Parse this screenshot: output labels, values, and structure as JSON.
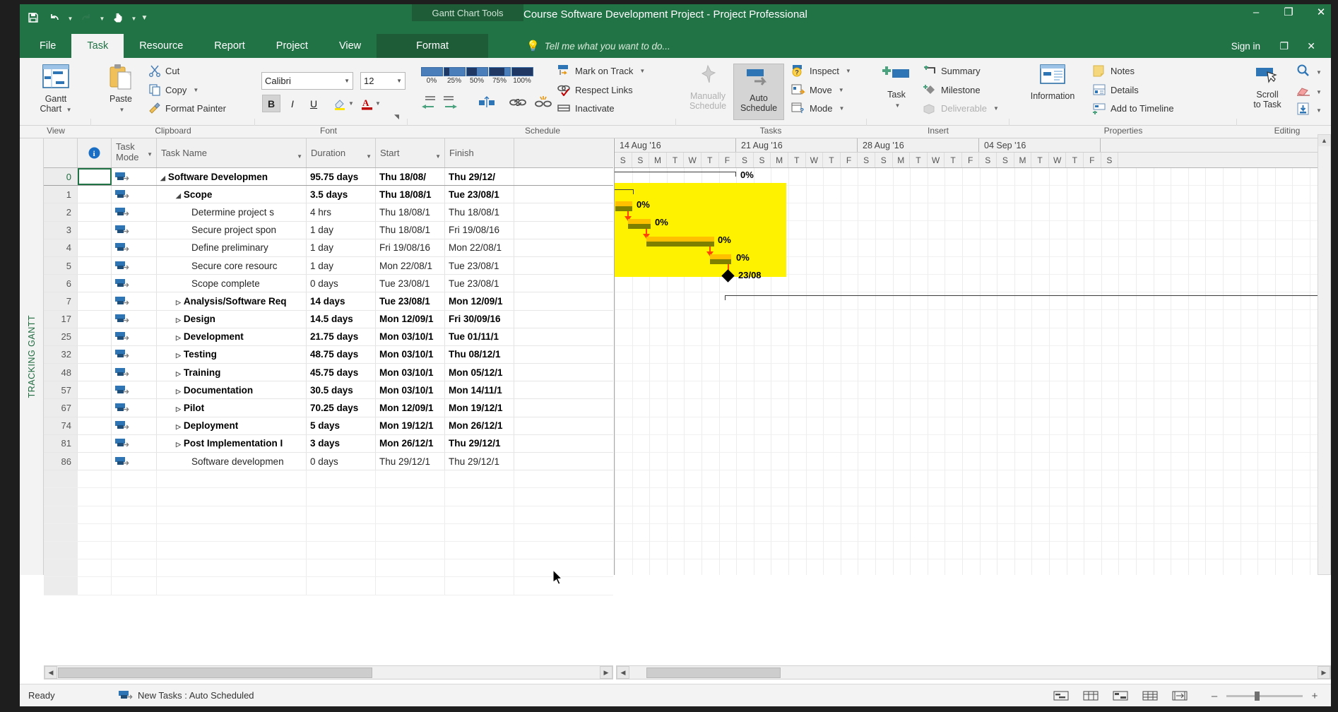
{
  "window": {
    "context_tab_group": "Gantt Chart Tools",
    "title": "Course Software Development Project - Project Professional",
    "minimize": "–",
    "restore": "❐",
    "close": "✕",
    "sign_in": "Sign in",
    "ribbon_display_options": "❐",
    "ribbon_close": "✕"
  },
  "quick_access": {
    "save": "save-icon",
    "undo": "undo-icon",
    "redo": "redo-icon",
    "touch_mode": "touch-mode-icon",
    "customize": "customize-icon"
  },
  "tabs": [
    {
      "label": "File",
      "active": false
    },
    {
      "label": "Task",
      "active": true
    },
    {
      "label": "Resource",
      "active": false
    },
    {
      "label": "Report",
      "active": false
    },
    {
      "label": "Project",
      "active": false
    },
    {
      "label": "View",
      "active": false
    },
    {
      "label": "Format",
      "active": false,
      "contextual": true
    }
  ],
  "tell_me": {
    "placeholder": "Tell me what you want to do..."
  },
  "ribbon": {
    "groups": [
      {
        "name": "View",
        "label": "View"
      },
      {
        "name": "Clipboard",
        "label": "Clipboard"
      },
      {
        "name": "Font",
        "label": "Font"
      },
      {
        "name": "Schedule",
        "label": "Schedule"
      },
      {
        "name": "Tasks",
        "label": "Tasks"
      },
      {
        "name": "Insert",
        "label": "Insert"
      },
      {
        "name": "Properties",
        "label": "Properties"
      },
      {
        "name": "Editing",
        "label": "Editing"
      }
    ],
    "view": {
      "gantt_chart_line1": "Gantt",
      "gantt_chart_line2": "Chart"
    },
    "clipboard": {
      "paste": "Paste",
      "cut": "Cut",
      "copy": "Copy",
      "format_painter": "Format Painter"
    },
    "font": {
      "font_name": "Calibri",
      "font_size": "12",
      "bold": "B",
      "italic": "I",
      "underline": "U",
      "highlight": "highlight-color-icon",
      "font_color": "A"
    },
    "schedule": {
      "percent_0": "0%",
      "percent_25": "25%",
      "percent_50": "50%",
      "percent_75": "75%",
      "percent_100": "100%",
      "mark_on_track": "Mark on Track",
      "respect_links": "Respect Links",
      "inactivate": "Inactivate"
    },
    "tasks": {
      "manually_schedule_line1": "Manually",
      "manually_schedule_line2": "Schedule",
      "auto_schedule_line1": "Auto",
      "auto_schedule_line2": "Schedule",
      "inspect": "Inspect",
      "move": "Move",
      "mode": "Mode"
    },
    "insert": {
      "task": "Task",
      "summary": "Summary",
      "milestone": "Milestone",
      "deliverable": "Deliverable"
    },
    "properties": {
      "information": "Information",
      "notes": "Notes",
      "details": "Details",
      "add_to_timeline": "Add to Timeline"
    },
    "editing": {
      "scroll_to_task_line1": "Scroll",
      "scroll_to_task_line2": "to Task",
      "find": "find-icon",
      "clear": "clear-icon",
      "fill": "fill-down-icon"
    }
  },
  "view_side_label": "TRACKING GANTT",
  "grid": {
    "headers": {
      "id": "",
      "indicator": "ⓘ",
      "task_mode_line1": "Task",
      "task_mode_line2": "Mode",
      "task_name": "Task Name",
      "duration": "Duration",
      "start": "Start",
      "finish": "Finish"
    },
    "rows": [
      {
        "id": "0",
        "name": "Software Developmen",
        "duration": "95.75 days",
        "start": "Thu 18/08/",
        "finish": "Thu 29/12/",
        "bold": true,
        "indent": 0,
        "twisty": "◢",
        "selected": true
      },
      {
        "id": "1",
        "name": "Scope",
        "duration": "3.5 days",
        "start": "Thu 18/08/1",
        "finish": "Tue 23/08/1",
        "bold": true,
        "indent": 1,
        "twisty": "◢"
      },
      {
        "id": "2",
        "name": "Determine project s",
        "duration": "4 hrs",
        "start": "Thu 18/08/1",
        "finish": "Thu 18/08/1",
        "bold": false,
        "indent": 2,
        "twisty": ""
      },
      {
        "id": "3",
        "name": "Secure project spon",
        "duration": "1 day",
        "start": "Thu 18/08/1",
        "finish": "Fri 19/08/16",
        "bold": false,
        "indent": 2,
        "twisty": ""
      },
      {
        "id": "4",
        "name": "Define preliminary",
        "duration": "1 day",
        "start": "Fri 19/08/16",
        "finish": "Mon 22/08/1",
        "bold": false,
        "indent": 2,
        "twisty": ""
      },
      {
        "id": "5",
        "name": "Secure core resourc",
        "duration": "1 day",
        "start": "Mon 22/08/1",
        "finish": "Tue 23/08/1",
        "bold": false,
        "indent": 2,
        "twisty": ""
      },
      {
        "id": "6",
        "name": "Scope complete",
        "duration": "0 days",
        "start": "Tue 23/08/1",
        "finish": "Tue 23/08/1",
        "bold": false,
        "indent": 2,
        "twisty": ""
      },
      {
        "id": "7",
        "name": "Analysis/Software Req",
        "duration": "14 days",
        "start": "Tue 23/08/1",
        "finish": "Mon 12/09/1",
        "bold": true,
        "indent": 1,
        "twisty": "▷"
      },
      {
        "id": "17",
        "name": "Design",
        "duration": "14.5 days",
        "start": "Mon 12/09/1",
        "finish": "Fri 30/09/16",
        "bold": true,
        "indent": 1,
        "twisty": "▷"
      },
      {
        "id": "25",
        "name": "Development",
        "duration": "21.75 days",
        "start": "Mon 03/10/1",
        "finish": "Tue 01/11/1",
        "bold": true,
        "indent": 1,
        "twisty": "▷"
      },
      {
        "id": "32",
        "name": "Testing",
        "duration": "48.75 days",
        "start": "Mon 03/10/1",
        "finish": "Thu 08/12/1",
        "bold": true,
        "indent": 1,
        "twisty": "▷"
      },
      {
        "id": "48",
        "name": "Training",
        "duration": "45.75 days",
        "start": "Mon 03/10/1",
        "finish": "Mon 05/12/1",
        "bold": true,
        "indent": 1,
        "twisty": "▷"
      },
      {
        "id": "57",
        "name": "Documentation",
        "duration": "30.5 days",
        "start": "Mon 03/10/1",
        "finish": "Mon 14/11/1",
        "bold": true,
        "indent": 1,
        "twisty": "▷"
      },
      {
        "id": "67",
        "name": "Pilot",
        "duration": "70.25 days",
        "start": "Mon 12/09/1",
        "finish": "Mon 19/12/1",
        "bold": true,
        "indent": 1,
        "twisty": "▷"
      },
      {
        "id": "74",
        "name": "Deployment",
        "duration": "5 days",
        "start": "Mon 19/12/1",
        "finish": "Mon 26/12/1",
        "bold": true,
        "indent": 1,
        "twisty": "▷"
      },
      {
        "id": "81",
        "name": "Post Implementation I",
        "duration": "3 days",
        "start": "Mon 26/12/1",
        "finish": "Thu 29/12/1",
        "bold": true,
        "indent": 1,
        "twisty": "▷"
      },
      {
        "id": "86",
        "name": "Software developmen",
        "duration": "0 days",
        "start": "Thu 29/12/1",
        "finish": "Thu 29/12/1",
        "bold": false,
        "indent": 2,
        "twisty": ""
      }
    ]
  },
  "gantt": {
    "timescale_weeks": [
      {
        "label": "14 Aug '16"
      },
      {
        "label": "21 Aug '16"
      },
      {
        "label": "28 Aug '16"
      },
      {
        "label": "04 Sep '16"
      }
    ],
    "day_letters": [
      "S",
      "S",
      "M",
      "T",
      "W",
      "T",
      "F",
      "S",
      "S",
      "M",
      "T",
      "W",
      "T",
      "F",
      "S",
      "S",
      "M",
      "T",
      "W",
      "T",
      "F",
      "S",
      "S",
      "M",
      "T",
      "W",
      "T",
      "F",
      "S"
    ],
    "bars": [
      {
        "name": "project-summary-outline",
        "label": "0%"
      },
      {
        "name": "scope-summary-outline",
        "label": ""
      },
      {
        "name": "determine-project-scope-bar",
        "label": "0%"
      },
      {
        "name": "secure-project-sponsorship-bar",
        "label": "0%"
      },
      {
        "name": "define-preliminary-resources-bar",
        "label": "0%"
      },
      {
        "name": "secure-core-resources-bar",
        "label": "0%"
      },
      {
        "name": "scope-complete-milestone",
        "label": "23/08"
      }
    ],
    "milestone_label": "23/08"
  },
  "status_bar": {
    "ready": "Ready",
    "new_tasks": "New Tasks : Auto Scheduled",
    "views": [
      "gantt-chart-view",
      "task-usage-view",
      "team-planner-view",
      "resource-sheet-view",
      "reports-view"
    ],
    "zoom_out": "–",
    "zoom_in": "+"
  }
}
